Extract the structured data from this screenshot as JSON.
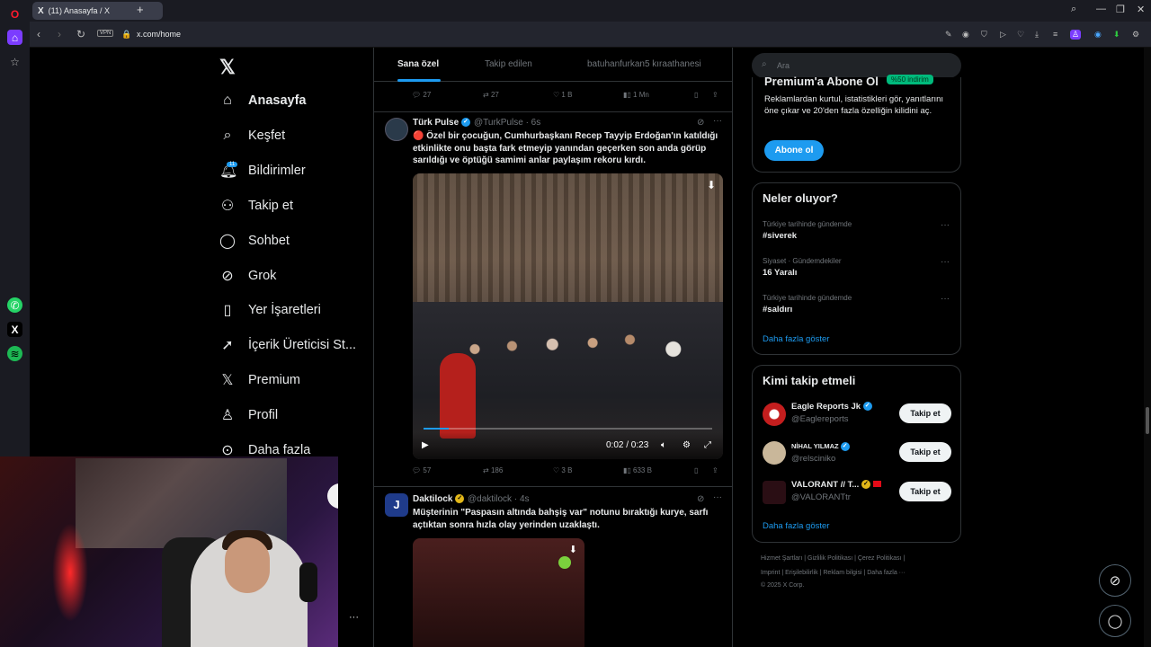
{
  "browser": {
    "tab_title": "(11) Anasayfa / X",
    "url": "x.com/home",
    "vpn": "VPN"
  },
  "nav": {
    "items": [
      {
        "label": "Anasayfa",
        "icon": "home-icon"
      },
      {
        "label": "Keşfet",
        "icon": "search-icon"
      },
      {
        "label": "Bildirimler",
        "icon": "bell-icon",
        "badge": "11"
      },
      {
        "label": "Takip et",
        "icon": "person-add-icon"
      },
      {
        "label": "Sohbet",
        "icon": "chat-icon"
      },
      {
        "label": "Grok",
        "icon": "grok-icon"
      },
      {
        "label": "Yer İşaretleri",
        "icon": "bookmark-icon"
      },
      {
        "label": "İçerik Üreticisi St...",
        "icon": "rocket-icon"
      },
      {
        "label": "Premium",
        "icon": "x-icon"
      },
      {
        "label": "Profil",
        "icon": "person-icon"
      },
      {
        "label": "Daha fazla",
        "icon": "more-icon"
      }
    ]
  },
  "feed": {
    "tabs": [
      "Sana özel",
      "Takip edilen",
      "batuhanfurkan5 kıraathanesi"
    ],
    "top_actions": {
      "replies": "27",
      "reposts": "27",
      "likes": "1 B",
      "views": "1 Mn"
    },
    "tweet1": {
      "name": "Türk Pulse",
      "handle": "@TurkPulse · 6s",
      "text": "🔴 Özel bir çocuğun, Cumhurbaşkanı Recep Tayyip Erdoğan'ın katıldığı etkinlikte onu başta fark etmeyip yanından geçerken son anda görüp sarıldığı ve öptüğü samimi anlar paylaşım rekoru kırdı.",
      "video_time": "0:02 / 0:23",
      "video_progress": 0.087,
      "replies": "57",
      "reposts": "186",
      "likes": "3 B",
      "views": "633 B"
    },
    "tweet2": {
      "name": "Daktilock",
      "handle": "@daktilock · 4s",
      "text": "Müşterinin \"Paspasın altında bahşiş var\" notunu bıraktığı kurye, sarfı açtıktan sonra hızla olay yerinden uzaklaştı."
    }
  },
  "right": {
    "search_placeholder": "Ara",
    "premium": {
      "title": "Premium'a Abone Ol",
      "pill": "%50 indirim",
      "text": "Reklamlardan kurtul, istatistikleri gör, yanıtlarını öne çıkar ve 20'den fazla özelliğin kilidini aç.",
      "button": "Abone ol"
    },
    "trends": {
      "title": "Neler oluyor?",
      "items": [
        {
          "context": "Türkiye tarihinde gündemde",
          "tag": "#siverek"
        },
        {
          "context": "Siyaset · Gündemdekiler",
          "tag": "16 Yaralı"
        },
        {
          "context": "Türkiye tarihinde gündemde",
          "tag": "#saldırı"
        }
      ],
      "more": "Daha fazla göster"
    },
    "who": {
      "title": "Kimi takip etmeli",
      "items": [
        {
          "name": "Eagle Reports Jk",
          "handle": "@Eaglereports",
          "button": "Takip et"
        },
        {
          "name": "NİHAL YILMAZ",
          "handle": "@relsciniko",
          "button": "Takip et"
        },
        {
          "name": "VALORANT // T...",
          "handle": "@VALORANTtr",
          "button": "Takip et"
        }
      ],
      "more": "Daha fazla göster"
    },
    "footer": {
      "line1": "Hizmet Şartları  |  Gizlilik Politikası  |  Çerez Politikası  |",
      "line2": "Imprint  |  Erişilebilirlik  |  Reklam bilgisi  |  Daha fazla ···",
      "line3": "© 2025 X Corp."
    }
  }
}
